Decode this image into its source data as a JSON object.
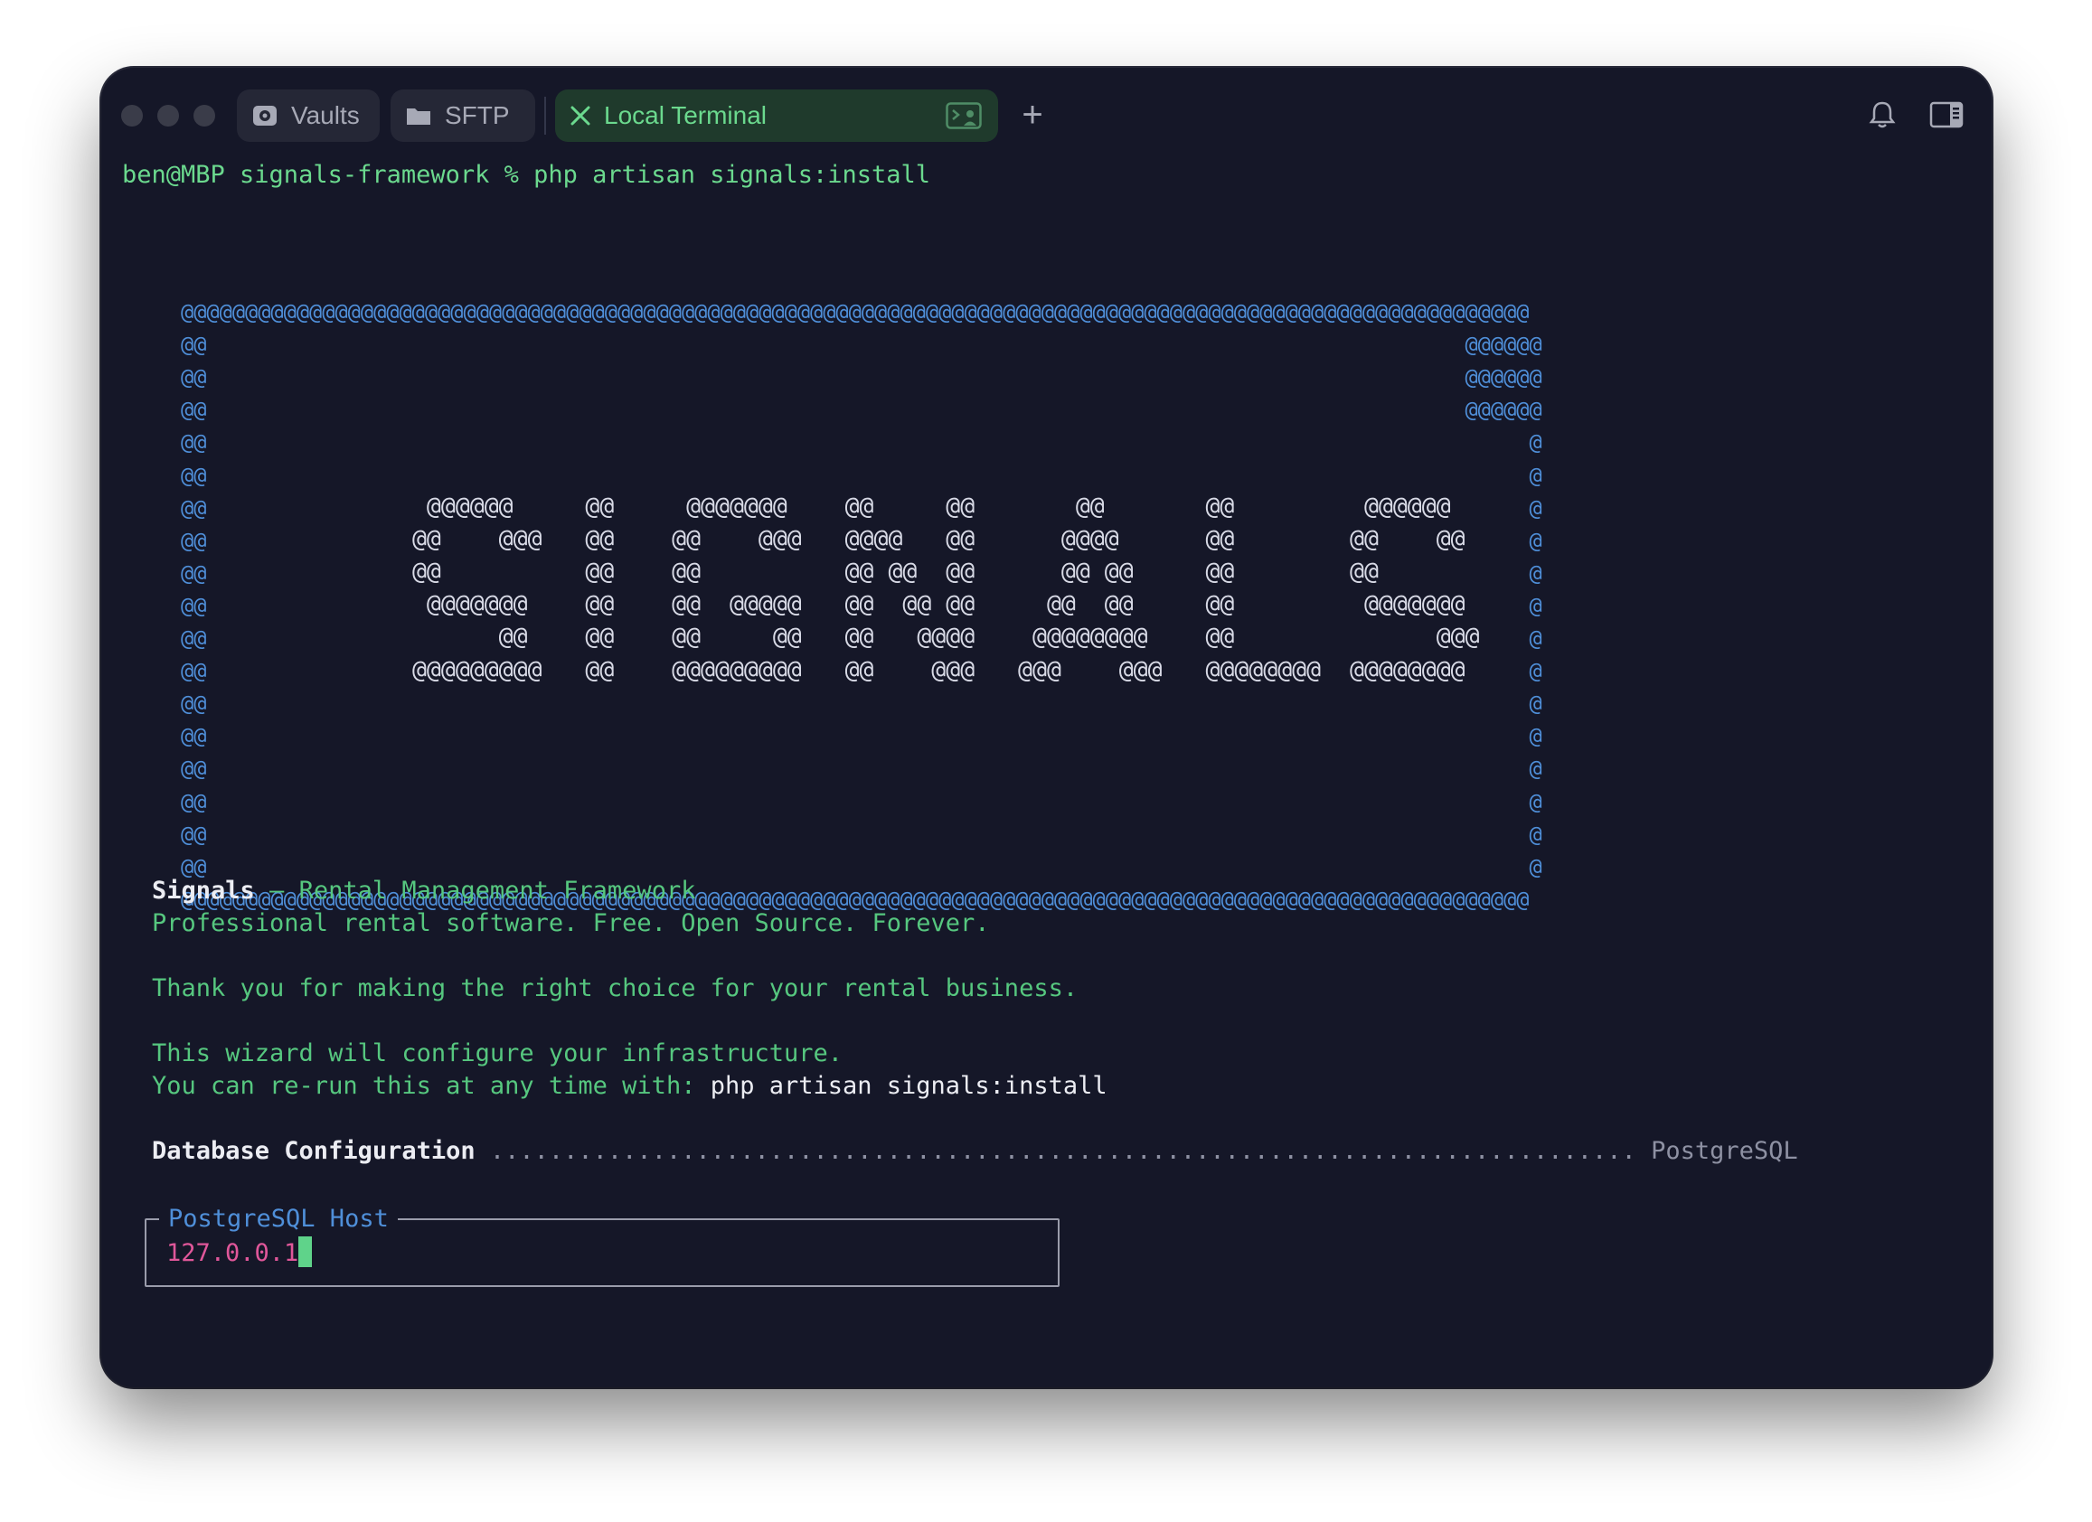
{
  "tabs": [
    {
      "label": "Vaults",
      "icon": "vault-icon"
    },
    {
      "label": "SFTP",
      "icon": "folder-icon"
    },
    {
      "label": "Local Terminal",
      "icon": "close-icon",
      "active": true
    }
  ],
  "titlebar": {
    "new_tab": "+",
    "notification_icon": "bell-icon",
    "sidebar_icon": "sidebar-toggle-icon",
    "terminal_icon": "terminal-user-icon"
  },
  "terminal": {
    "prompt": "ben@MBP signals-framework % php artisan signals:install",
    "art_border_lines": [
      "@@@@@@@@@@@@@@@@@@@@@@@@@@@@@@@@@@@@@@@@@@@@@@@@@@@@@@@@@@@@@@@@@@@@@@@@@@@@@@@@@@@@@@@@@@@@@@@@@@@@@@@@@",
      "@@                                                                                                  @@@@@@",
      "@@                                                                                                  @@@@@@",
      "@@                                                                                                  @@@@@@",
      "@@                                                                                                       @",
      "@@                                                                                                       @",
      "@@                                                                                                       @",
      "@@                                                                                                       @",
      "@@                                                                                                       @",
      "@@                                                                                                       @",
      "@@                                                                                                       @",
      "@@                                                                                                       @",
      "@@                                                                                                       @",
      "@@                                                                                                       @",
      "@@                                                                                                       @",
      "@@                                                                                                       @",
      "@@                                                                                                       @",
      "@@                                                                                                       @",
      "@@@@@@@@@@@@@@@@@@@@@@@@@@@@@@@@@@@@@@@@@@@@@@@@@@@@@@@@@@@@@@@@@@@@@@@@@@@@@@@@@@@@@@@@@@@@@@@@@@@@@@@@@"
    ],
    "art_logo_lines": [
      "  @@@@@@     @@     @@@@@@@    @@     @@       @@       @@         @@@@@@",
      " @@    @@@   @@    @@    @@@   @@@@   @@      @@@@      @@        @@    @@",
      " @@          @@    @@          @@ @@  @@      @@ @@     @@        @@",
      "  @@@@@@@    @@    @@  @@@@@   @@  @@ @@     @@  @@     @@         @@@@@@@",
      "       @@    @@    @@     @@   @@   @@@@    @@@@@@@@    @@              @@@",
      " @@@@@@@@@   @@    @@@@@@@@@   @@    @@@   @@@    @@@   @@@@@@@@  @@@@@@@@"
    ],
    "signals_title": "Signals",
    "signals_subtitle": " — Rental Management Framework",
    "tagline": "Professional rental software. Free. Open Source. Forever.",
    "thanks": "Thank you for making the right choice for your rental business.",
    "wizard": "This wizard will configure your infrastructure.",
    "rerun_prefix": "You can re-run this at any time with: ",
    "rerun_command": "php artisan signals:install",
    "db_label": "Database Configuration",
    "db_dots": " .............................................................................. ",
    "db_value": "PostgreSQL",
    "input_label": "PostgreSQL Host",
    "input_value": "127.0.0.1"
  }
}
